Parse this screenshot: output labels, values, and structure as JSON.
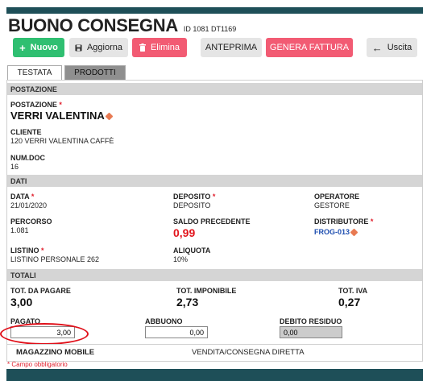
{
  "header": {
    "title": "BUONO CONSEGNA",
    "id_text": "ID 1081 DT1169"
  },
  "toolbar": {
    "nuovo": "Nuovo",
    "aggiorna": "Aggiorna",
    "elimina": "Elimina",
    "anteprima": "ANTEPRIMA",
    "genera_fattura": "GENERA FATTURA",
    "uscita": "Uscita"
  },
  "tabs": [
    {
      "label": "TESTATA"
    },
    {
      "label": "PRODOTTI"
    }
  ],
  "postazione_section": {
    "title": "POSTAZIONE",
    "postazione_label": "POSTAZIONE",
    "postazione_value": "VERRI VALENTINA",
    "cliente_label": "CLIENTE",
    "cliente_value": "120 VERRI VALENTINA CAFFÈ",
    "numdoc_label": "NUM.DOC",
    "numdoc_value": "16"
  },
  "dati_section": {
    "title": "DATI",
    "data_label": "DATA",
    "data_value": "21/01/2020",
    "deposito_label": "DEPOSITO",
    "deposito_value": "DEPOSITO",
    "operatore_label": "OPERATORE",
    "operatore_value": "GESTORE",
    "percorso_label": "PERCORSO",
    "percorso_value": "1.081",
    "saldo_label": "SALDO PRECEDENTE",
    "saldo_value": "0,99",
    "distributore_label": "DISTRIBUTORE",
    "distributore_value": "FROG-013",
    "listino_label": "LISTINO",
    "listino_value": "LISTINO PERSONALE 262",
    "aliquota_label": "ALIQUOTA",
    "aliquota_value": "10%"
  },
  "totali_section": {
    "title": "TOTALI",
    "tot_pagare_label": "TOT. DA PAGARE",
    "tot_pagare_value": "3,00",
    "tot_imponibile_label": "TOT. IMPONIBILE",
    "tot_imponibile_value": "2,73",
    "tot_iva_label": "TOT. IVA",
    "tot_iva_value": "0,27",
    "pagato_label": "PAGATO",
    "pagato_value": "3,00",
    "abbuono_label": "ABBUONO",
    "abbuono_value": "0,00",
    "debito_label": "DEBITO RESIDUO",
    "debito_value": "0,00"
  },
  "footer_row": {
    "magazzino": "MAGAZZINO MOBILE",
    "vendita": "VENDITA/CONSEGNA DIRETTA"
  },
  "required_note": "* Campo obbligatorio",
  "required_mark": "*",
  "colors": {
    "accent_dark": "#1e4f58",
    "green": "#2fbf71",
    "pink": "#f25b73",
    "red": "#e2151d",
    "link": "#1f4fb0"
  }
}
